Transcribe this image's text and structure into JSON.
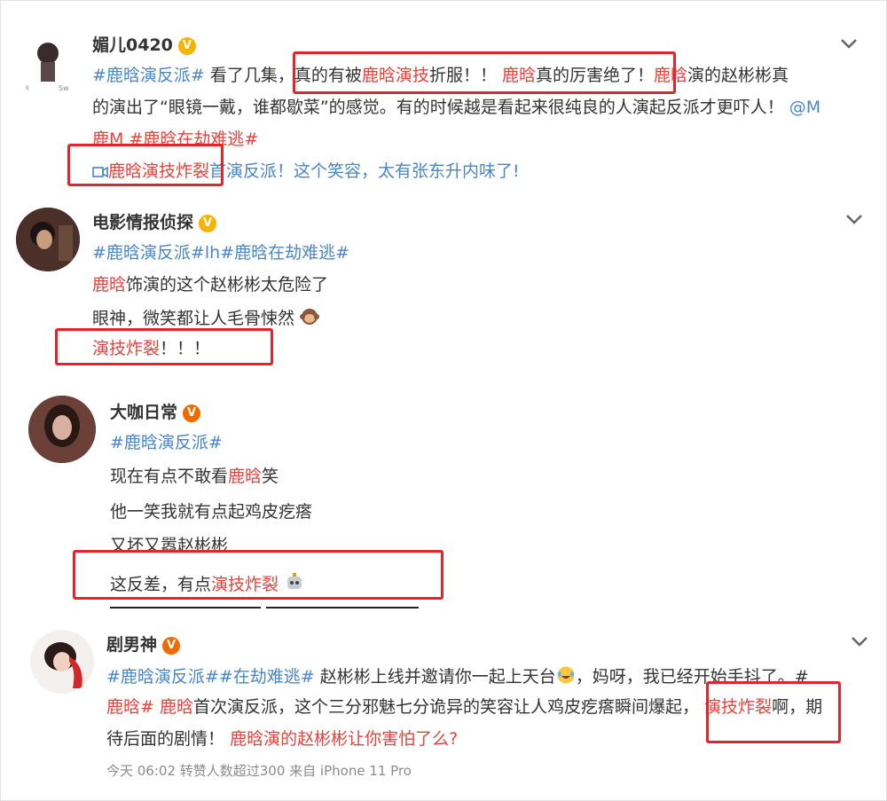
{
  "posts": [
    {
      "user": "媚儿0420",
      "badge": "V",
      "badge_color": "#f6b400",
      "text": {
        "tag_fanpai": "#鹿晗演反派#",
        "t1": "看了几集，",
        "t2": "真的有被",
        "lh_yanji": "鹿晗演技",
        "t3": "折服！！",
        "lh": "鹿晗",
        "t4": "真的厉害绝了！",
        "lh2": "鹿晗",
        "t5": "演的赵彬彬真",
        "line2": "的演出了“眼镜一戴，谁都歇菜”的感觉。有的时候越是看起来很纯良的人演起反派才更吓人！",
        "at": "@M",
        "at2": "鹿M",
        "tag_jienan": "#鹿晗在劫难逃#",
        "video_lh": "鹿晗演技炸裂",
        "video_rest": "首演反派！这个笑容，太有张东升内味了!"
      }
    },
    {
      "user": "电影情报侦探",
      "badge": "V",
      "badge_color": "#f6b400",
      "text": {
        "tags": "#鹿晗演反派#lh#鹿晗在劫难逃#",
        "lh": "鹿晗",
        "line2": "饰演的这个赵彬彬太危险了",
        "line3": "眼神，微笑都让人毛骨悚然",
        "yanji": "演技炸裂",
        "exclaim": "！！！"
      }
    },
    {
      "user": "大咖日常",
      "badge": "V",
      "badge_color": "#f06a00",
      "text": {
        "tag": "#鹿晗演反派#",
        "line2a": "现在有点不敢看",
        "lh": "鹿晗",
        "line2b": "笑",
        "line3": "他一笑我就有点起鸡皮疙瘩",
        "line4": "又坏又嚣赵彬彬",
        "line5a": "这反差，有点",
        "yanji": "演技炸裂"
      }
    },
    {
      "user": "剧男神",
      "badge": "V",
      "badge_color": "#f06a00",
      "text": {
        "tags": "#鹿晗演反派##在劫难逃#",
        "t1": "赵彬彬上线并邀请你一起上天台",
        "t2": "，妈呀，我已经开始手抖了。#",
        "lh_tag": "鹿晗#",
        "lh": "鹿晗",
        "t3": "首次演反派，这个三分邪魅七分诡异的笑容让人鸡皮疙瘩瞬间爆起，",
        "yanji": "演技炸裂",
        "t4": "啊，期",
        "line3a": "待后面的剧情！",
        "line3b": "鹿晗演的赵彬彬让你害怕了么?"
      },
      "meta": "今天 06:02 转赞人数超过300  来自 iPhone 11 Pro"
    }
  ]
}
